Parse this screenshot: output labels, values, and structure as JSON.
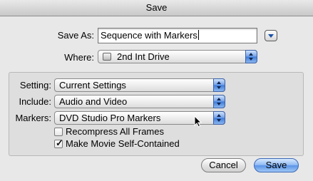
{
  "window": {
    "title": "Save"
  },
  "save_as": {
    "label": "Save As:",
    "value": "Sequence with Markers"
  },
  "where": {
    "label": "Where:",
    "value": "2nd Int Drive",
    "icon": "hard-drive-icon"
  },
  "options": {
    "setting": {
      "label": "Setting:",
      "value": "Current Settings"
    },
    "include": {
      "label": "Include:",
      "value": "Audio and Video"
    },
    "markers": {
      "label": "Markers:",
      "value": "DVD Studio Pro Markers"
    },
    "recompress": {
      "label": "Recompress All Frames",
      "checked": false
    },
    "self_contained": {
      "label": "Make Movie Self-Contained",
      "checked": true
    }
  },
  "buttons": {
    "cancel": "Cancel",
    "save": "Save"
  },
  "colors": {
    "accent": "#5a93e6",
    "background": "#e8e8e8"
  }
}
